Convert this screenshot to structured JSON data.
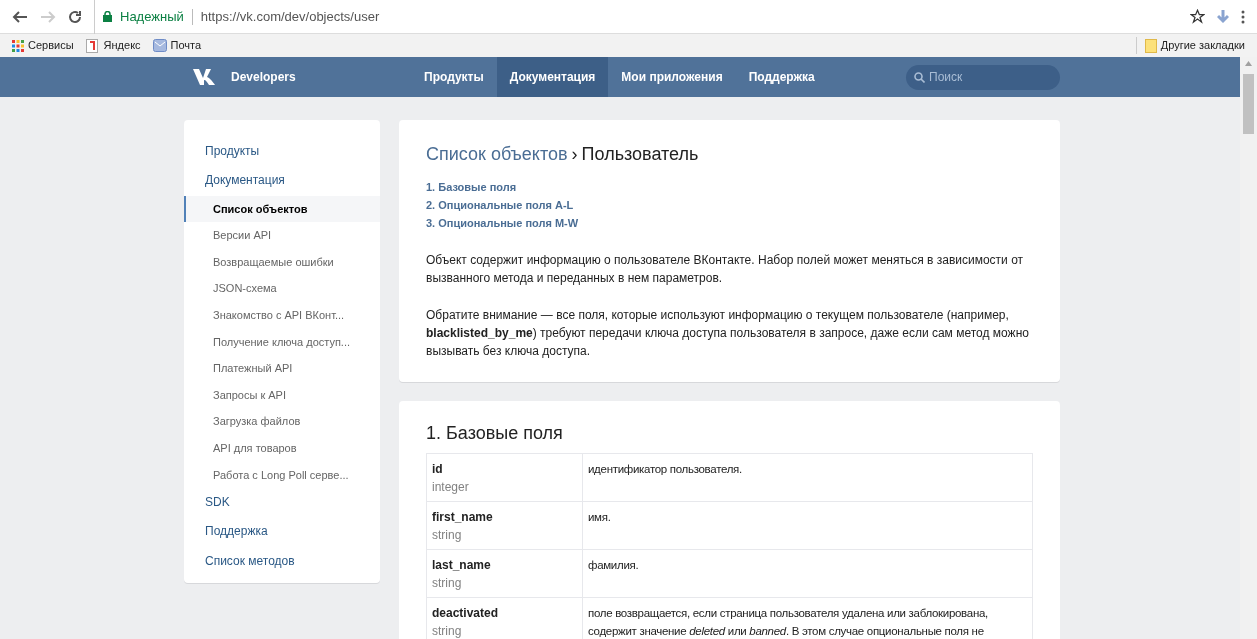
{
  "browser": {
    "secure_label": "Надежный",
    "url": "https://vk.com/dev/objects/user",
    "bookmarks": [
      "Сервисы",
      "Яндекс",
      "Почта"
    ],
    "other_bookmarks": "Другие закладки"
  },
  "header": {
    "brand": "Developers",
    "nav": [
      {
        "label": "Продукты",
        "selected": false
      },
      {
        "label": "Документация",
        "selected": true
      },
      {
        "label": "Мои приложения",
        "selected": false
      },
      {
        "label": "Поддержка",
        "selected": false
      }
    ],
    "search": {
      "placeholder": "Поиск"
    }
  },
  "sidebar": {
    "items": [
      {
        "label": "Продукты",
        "selected": false
      },
      {
        "label": "Документация",
        "selected": false,
        "children": [
          {
            "label": "Список объектов",
            "selected": true
          },
          {
            "label": "Версии API",
            "selected": false
          },
          {
            "label": "Возвращаемые ошибки",
            "selected": false
          },
          {
            "label": "JSON-схема",
            "selected": false
          },
          {
            "label": "Знакомство с API ВКонт...",
            "selected": false
          },
          {
            "label": "Получение ключа доступ...",
            "selected": false
          },
          {
            "label": "Платежный API",
            "selected": false
          },
          {
            "label": "Запросы к API",
            "selected": false
          },
          {
            "label": "Загрузка файлов",
            "selected": false
          },
          {
            "label": "API для товаров",
            "selected": false
          },
          {
            "label": "Работа с Long Poll серве...",
            "selected": false
          }
        ]
      },
      {
        "label": "SDK",
        "selected": false
      },
      {
        "label": "Поддержка",
        "selected": false
      },
      {
        "label": "Список методов",
        "selected": false
      }
    ]
  },
  "intro": {
    "breadcrumb": "Список объектов",
    "separator": "›",
    "title": "Пользователь",
    "toc": [
      "1. Базовые поля",
      "2. Опциональные поля A-L",
      "3. Опциональные поля M-W"
    ],
    "paragraphs": [
      "Объект содержит информацию о пользователе ВКонтакте. Набор полей может меняться в зависимости от вызванного метода и переданных в нем параметров.",
      "Обратите внимание — все поля, которые используют информацию о текущем пользователе (например, **blacklisted_by_me**) требуют передачи ключа доступа пользователя в запросе, даже если сам метод можно вызывать без ключа доступа."
    ]
  },
  "section": {
    "title": "1. Базовые поля",
    "rows": [
      {
        "name": "id",
        "type": "integer",
        "description": "идентификатор пользователя."
      },
      {
        "name": "first_name",
        "type": "string",
        "description": "имя."
      },
      {
        "name": "last_name",
        "type": "string",
        "description": "фамилия."
      },
      {
        "name": "deactivated",
        "type": "string",
        "description": "поле возвращается, если страница пользователя удалена или заблокирована, содержит значение *deleted* или *banned*. В этом случае опциональные поля не"
      }
    ]
  }
}
